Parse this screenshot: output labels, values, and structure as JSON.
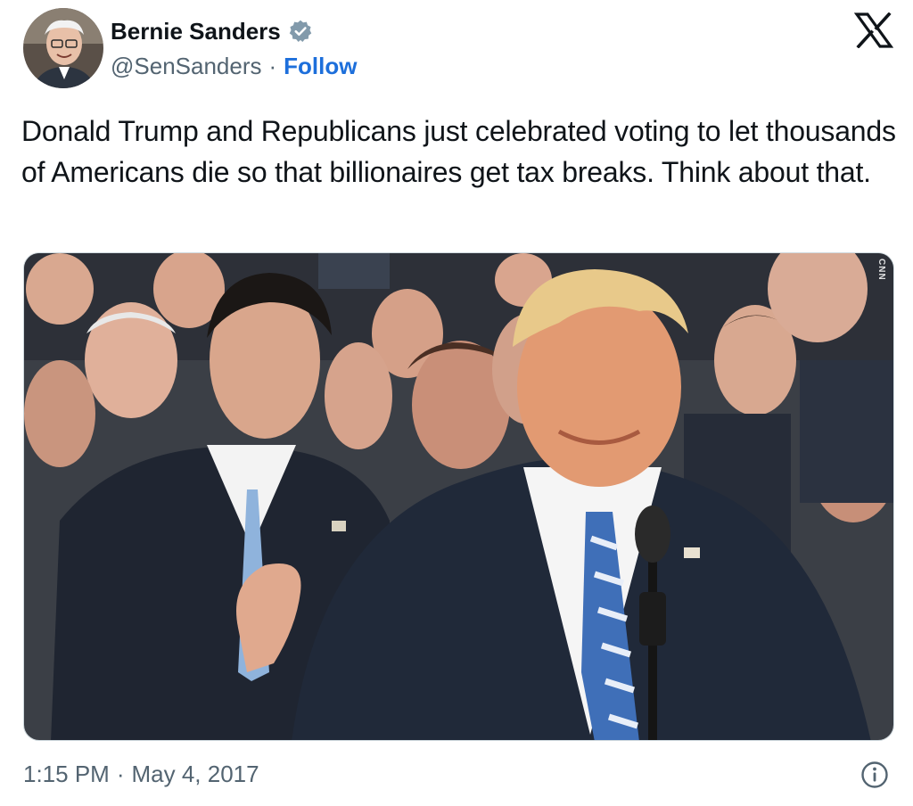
{
  "author": {
    "name": "Bernie Sanders",
    "handle": "@SenSanders",
    "separator": "·",
    "follow_label": "Follow",
    "verified_icon": "verified-badge-icon",
    "avatar_icon": "profile-avatar"
  },
  "platform_logo": "x-logo-icon",
  "tweet": {
    "text": "Donald Trump and Republicans just celebrated voting to let thousands of Americans die so that billionaires get tax breaks. Think about that."
  },
  "media": {
    "type": "photo",
    "watermark": "CNN"
  },
  "footer": {
    "time": "1:15 PM",
    "separator": "·",
    "date": "May 4, 2017",
    "info_icon": "info-icon"
  },
  "colors": {
    "text": "#0f1419",
    "secondary": "#536471",
    "link": "#1d6fdb",
    "verified": "#829aab",
    "border": "#cfd9de"
  }
}
